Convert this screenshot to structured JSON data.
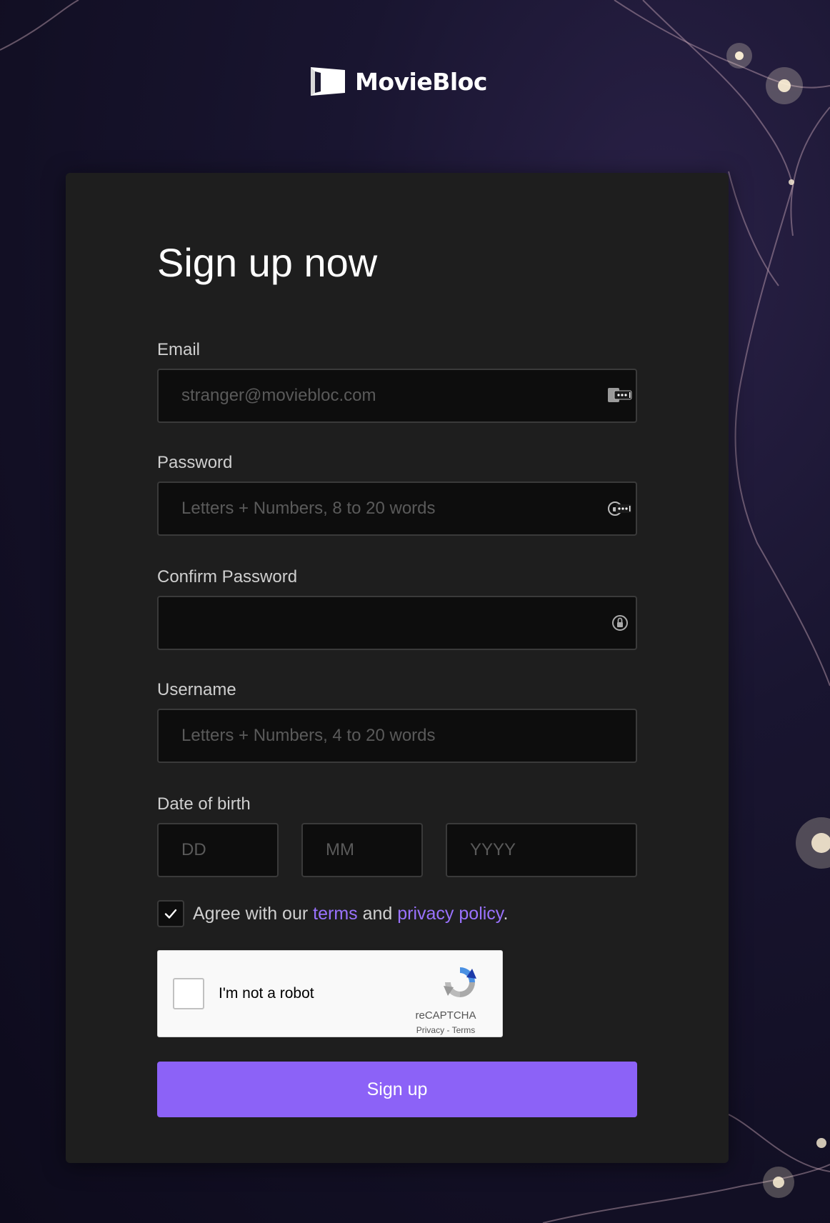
{
  "brand": {
    "name": "MovieBloc"
  },
  "form": {
    "title": "Sign up now",
    "email": {
      "label": "Email",
      "placeholder": "stranger@moviebloc.com",
      "value": ""
    },
    "password": {
      "label": "Password",
      "placeholder": "Letters + Numbers, 8 to 20 words",
      "value": ""
    },
    "confirm_password": {
      "label": "Confirm Password",
      "placeholder": "",
      "value": ""
    },
    "username": {
      "label": "Username",
      "placeholder": "Letters + Numbers, 4 to 20 words",
      "value": ""
    },
    "date_of_birth": {
      "label": "Date of birth",
      "day_placeholder": "DD",
      "month_placeholder": "MM",
      "year_placeholder": "YYYY"
    },
    "agree": {
      "checked": true,
      "prefix": "Agree with our ",
      "terms_link": "terms",
      "conjunction": " and ",
      "privacy_link": "privacy policy",
      "suffix": "."
    },
    "recaptcha": {
      "label": "I'm not a robot",
      "brand": "reCAPTCHA",
      "privacy": "Privacy",
      "separator": " - ",
      "terms": "Terms"
    },
    "submit_label": "Sign up"
  },
  "icons": {
    "email_field_icon": "password-manager-icon",
    "password_field_icon": "password-manager-icon",
    "confirm_password_field_icon": "password-key-icon",
    "agree_checkbox_icon": "checkmark-icon",
    "recaptcha_logo": "recaptcha-icon"
  },
  "colors": {
    "accent": "#8c62f7",
    "link": "#9a72ff",
    "card": "#1e1e1e",
    "input_bg": "#0d0d0d"
  }
}
